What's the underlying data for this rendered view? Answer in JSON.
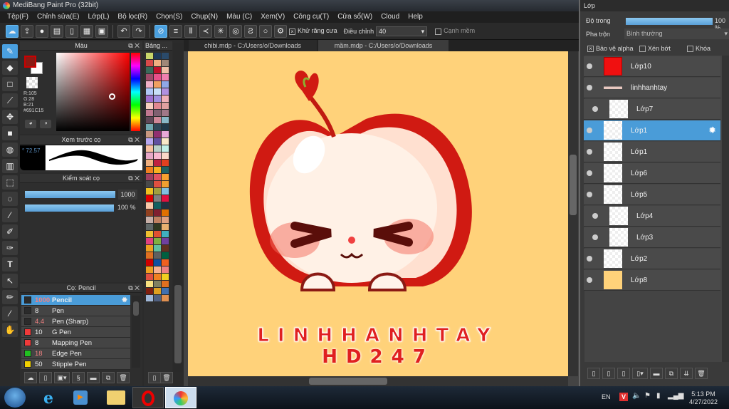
{
  "app": {
    "title": "MediBang Paint Pro (32bit)"
  },
  "menu": [
    "Tệp(F)",
    "Chỉnh sửa(E)",
    "Lớp(L)",
    "Bộ lọc(R)",
    "Chọn(S)",
    "Chụp(N)",
    "Màu (C)",
    "Xem(V)",
    "Công cụ(T)",
    "Cửa sổ(W)",
    "Cloud",
    "Help"
  ],
  "toolbar": {
    "antialias_label": "Khử răng cưa",
    "antialias_checked": true,
    "adjust_label": "Điều chỉnh",
    "adjust_value": "40",
    "soft_edge_label": "Cạnh mềm"
  },
  "color_panel": {
    "title": "Màu",
    "r": "R:105",
    "g": "G:28",
    "b": "B:21",
    "hex": "#691C15",
    "primary": "#8b1a14",
    "secondary": "#ffffff"
  },
  "palette_panel": {
    "title": "Bảng ...",
    "colors": [
      "#c8d66a",
      "#1e3a5a",
      "#2a4a6a",
      "#d84a4a",
      "#f0b080",
      "#a08878",
      "#3a6a5a",
      "#c0102a",
      "#f0c0a8",
      "#a04a6a",
      "#e8508a",
      "#f080b0",
      "#f0b0c8",
      "#f0a060",
      "#90a8e8",
      "#b0c8f8",
      "#c8e0f8",
      "#b090e0",
      "#a070d0",
      "#a090e0",
      "#f0b0b8",
      "#f8d0c0",
      "#e08890",
      "#e0a0a0",
      "#c07890",
      "#806070",
      "#a07888",
      "#604858",
      "#d08898",
      "#88b8c8",
      "#70a8b0",
      "#304858",
      "#203848",
      "#c89880",
      "#903070",
      "#e8a8d8",
      "#b8a8f0",
      "#6050a0",
      "#f8e8c8",
      "#f8c0a0",
      "#b8d0c8",
      "#c0f0e8",
      "#e8a8c8",
      "#f8b8d0",
      "#f8d8c8",
      "#f0b080",
      "#c02040",
      "#e04020",
      "#f08020",
      "#f8b020",
      "#206060",
      "#a04060",
      "#e05060",
      "#f8a030",
      "#4a4a4a",
      "#e05040",
      "#f0a030",
      "#f0c020",
      "#a0a040",
      "#80c0e0",
      "#e00000",
      "#808080",
      "#e01040",
      "#f8c8a8",
      "#106060",
      "#203040",
      "#904020",
      "#802030",
      "#e07000",
      "#c8b0a8",
      "#c08060",
      "#e0a080",
      "#606868",
      "#303820",
      "#e8b070",
      "#f0c030",
      "#e05030",
      "#40b0c0",
      "#e04080",
      "#80b040",
      "#7040a0",
      "#f0a020",
      "#60c0a0",
      "#603020",
      "#e07020",
      "#606060",
      "#006040",
      "#d00000",
      "#1050a0",
      "#f06020",
      "#f0a020",
      "#f8b090",
      "#f08080",
      "#e05040",
      "#f08020",
      "#f0d020",
      "#f8e080",
      "#808060",
      "#e07020",
      "#802010",
      "#e0a020",
      "#4070b0",
      "#a0b8d8",
      "#506080",
      "#e09050"
    ]
  },
  "brush_preview": {
    "title": "Xem trước cọ",
    "size": "72.57"
  },
  "brush_control": {
    "title": "Kiểm soát cọ",
    "size_value": "1000",
    "opacity_value": "100 %"
  },
  "brush_list": {
    "title": "Cọ: Pencil",
    "items": [
      {
        "size": "1000",
        "name": "Pencil",
        "color": "#2b2b2b",
        "selected": true
      },
      {
        "size": "8",
        "name": "Pen",
        "color": "#2b2b2b"
      },
      {
        "size": "4.4",
        "name": "Pen (Sharp)",
        "color": "#2b2b2b"
      },
      {
        "size": "10",
        "name": "G Pen",
        "color": "#f03a3a"
      },
      {
        "size": "8",
        "name": "Mapping Pen",
        "color": "#f03a3a"
      },
      {
        "size": "18",
        "name": "Edge Pen",
        "color": "#20c020"
      },
      {
        "size": "50",
        "name": "Stipple Pen",
        "color": "#f0d000"
      }
    ]
  },
  "tabs": [
    {
      "label": "chibi.mdp - C:/Users/o/Downloads",
      "active": false
    },
    {
      "label": "mầm.mdp - C:/Users/o/Downloads",
      "active": true
    }
  ],
  "canvas": {
    "background": "#ffd27a",
    "line1": "LINHHANHTAY",
    "line2": "HD247"
  },
  "layers_panel": {
    "title": "Lớp",
    "opacity_label": "Độ trong",
    "opacity_value": "100 %",
    "opacity_fraction": 1.0,
    "blend_label": "Pha trộn",
    "blend_value": "Bình thường",
    "protect_alpha": "Bảo vệ alpha",
    "clipping": "Xén bớt",
    "lock": "Khóa",
    "layers": [
      {
        "name": "Lớp10",
        "thumb": "red"
      },
      {
        "name": "linhhanhtay",
        "thumb": "line"
      },
      {
        "name": "Lớp7",
        "thumb": "check",
        "child": true
      },
      {
        "name": "Lớp1",
        "thumb": "check",
        "selected": true
      },
      {
        "name": "Lớp1",
        "thumb": "check"
      },
      {
        "name": "Lớp6",
        "thumb": "check"
      },
      {
        "name": "Lớp5",
        "thumb": "check"
      },
      {
        "name": "Lớp4",
        "thumb": "check",
        "child": true
      },
      {
        "name": "Lớp3",
        "thumb": "check",
        "child": true
      },
      {
        "name": "Lớp2",
        "thumb": "check"
      },
      {
        "name": "Lớp8",
        "thumb": "yellow"
      }
    ]
  },
  "taskbar": {
    "lang": "EN",
    "time": "5:13 PM",
    "date": "4/27/2022"
  }
}
